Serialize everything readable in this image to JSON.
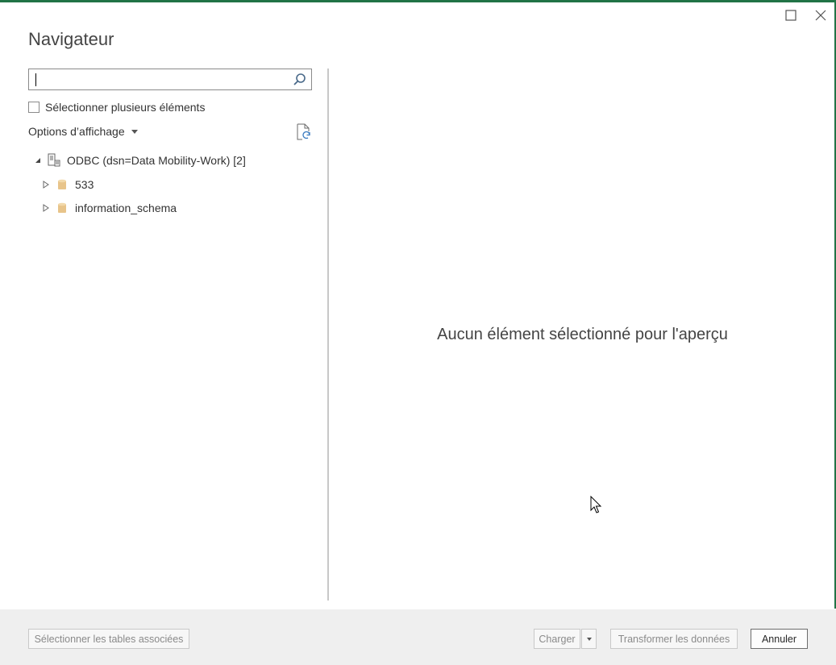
{
  "window": {
    "title": "Navigateur",
    "accent_color": "#217346",
    "controls": [
      "maximize-icon",
      "close-icon"
    ]
  },
  "search": {
    "value": "",
    "placeholder": "",
    "icon": "search-icon"
  },
  "multi_select": {
    "label": "Sélectionner plusieurs éléments",
    "checked": false
  },
  "display_options": {
    "label": "Options d’affichage",
    "refresh_icon": "refresh-icon"
  },
  "tree": {
    "root": {
      "label": "ODBC (dsn=Data Mobility-Work) [2]",
      "expanded": true,
      "icon": "odbc-server-icon"
    },
    "children": [
      {
        "label": "533",
        "expanded": false,
        "icon": "database-icon"
      },
      {
        "label": "information_schema",
        "expanded": false,
        "icon": "database-icon"
      }
    ]
  },
  "preview": {
    "empty_message": "Aucun élément sélectionné pour l'aperçu"
  },
  "footer": {
    "select_related_label": "Sélectionner les tables associées",
    "load_label": "Charger",
    "transform_label": "Transformer les données",
    "cancel_label": "Annuler"
  }
}
